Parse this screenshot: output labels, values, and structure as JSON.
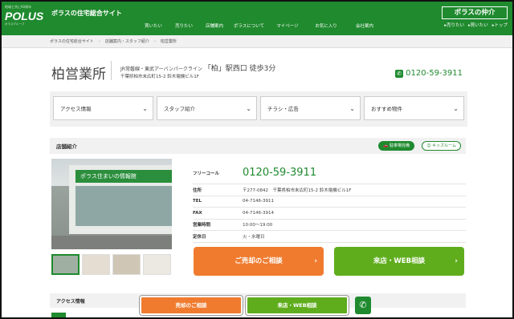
{
  "header": {
    "logo_tagline": "地域と共に60周年",
    "logo_text": "POLUS",
    "logo_sub": "ポラスグループ",
    "site_title": "ポラスの住宅総合サイト",
    "nav": [
      "買いたい",
      "売りたい",
      "店舗案内",
      "ポラスについて",
      "マイページ",
      "お気に入り",
      "会社案内"
    ],
    "brand_name": "ポラスの仲介",
    "brand_nav": [
      "▸売りたい",
      "▸買いたい",
      "▸トップ"
    ]
  },
  "breadcrumb": [
    "ポラスの住宅総合サイト",
    "店舗案内・スタッフ紹介",
    "柏営業所"
  ],
  "store": {
    "name": "柏営業所",
    "station_prefix": "JR常磐線・東武アーバンパークライン",
    "station_main": "「柏」駅西口 徒歩3分",
    "address": "千葉県柏市末広町15-2 鈴木電機ビル1F",
    "phone": "0120-59-3911"
  },
  "dropdowns": [
    "アクセス情報",
    "スタッフ紹介",
    "チラシ・広告",
    "おすすめ物件"
  ],
  "section": {
    "title": "店舗紹介",
    "badge_parking": "駐車場完備",
    "badge_kids": "キッズルーム"
  },
  "photo": {
    "sign_text": "ポラス住まいの情報館"
  },
  "info_rows": [
    {
      "label": "フリーコール",
      "value": "0120-59-3911"
    },
    {
      "label": "住所",
      "value": "〒277-0842　千葉県柏市末広町15-2 鈴木電機ビル1F"
    },
    {
      "label": "TEL",
      "value": "04-7146-3911"
    },
    {
      "label": "FAX",
      "value": "04-7146-3914"
    },
    {
      "label": "営業時間",
      "value": "10:00〜19:00"
    },
    {
      "label": "定休日",
      "value": "火・水曜日"
    }
  ],
  "cta": {
    "sell": "ご売却のご相談",
    "visit": "来店・WEB相談"
  },
  "access_title": "アクセス情報",
  "floating": {
    "sell": "売却のご相談",
    "visit": "来店・WEB相談"
  },
  "colors": {
    "brand_green": "#1f8a2e",
    "orange": "#f07b2f",
    "lime": "#5fad1d"
  }
}
